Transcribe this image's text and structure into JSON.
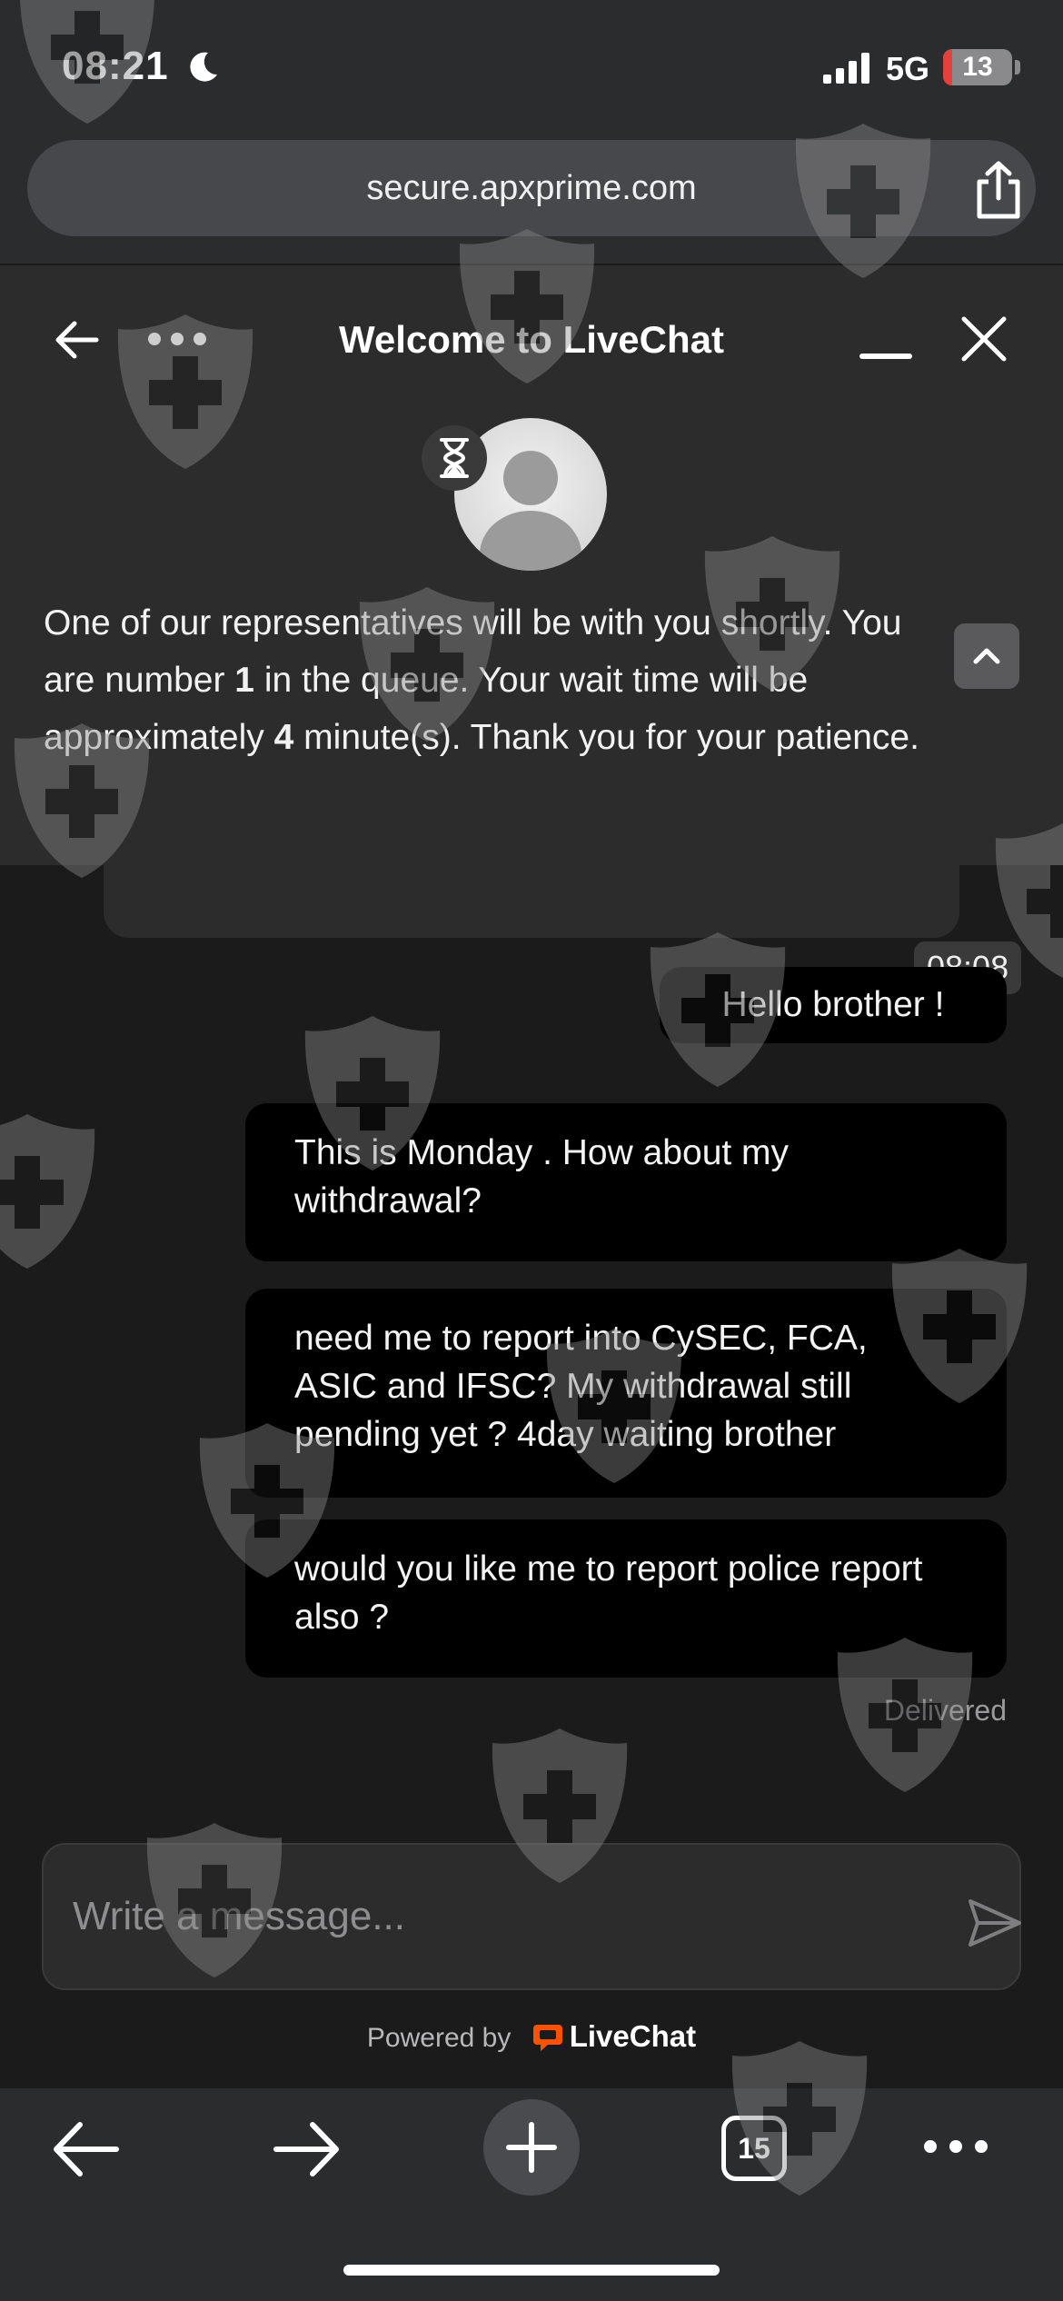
{
  "status_bar": {
    "time": "08:21",
    "network": "5G",
    "battery": "13",
    "battery_level": 0.13,
    "icons": [
      "moon-icon",
      "signal-icon",
      "battery-icon"
    ]
  },
  "browser": {
    "url": "secure.apxprime.com",
    "icons": [
      "share-icon"
    ]
  },
  "chat_header": {
    "title": "Welcome to LiveChat",
    "queue_text_1": "One of our representatives will be with you shortly. You are number ",
    "queue_number": "1",
    "queue_text_2": " in the queue. Your wait time will be approximately ",
    "wait_minutes": "4",
    "queue_text_3": " minute(s). Thank you for your patience.",
    "icons": [
      "back-icon",
      "more-icon",
      "minimize-icon",
      "close-icon",
      "hourglass-icon",
      "chevron-up-icon"
    ]
  },
  "messages": {
    "timestamp": "08:08",
    "items": [
      {
        "text": "Hello brother !"
      },
      {
        "text": "This is Monday . How about my withdrawal?"
      },
      {
        "text": "need me to report into CySEC, FCA, ASIC and IFSC? My withdrawal still pending yet ? 4day waiting brother"
      },
      {
        "text": "would you like me to report police report also ?"
      }
    ],
    "status": "Delivered"
  },
  "composer": {
    "placeholder": "Write a message...",
    "powered_by": "Powered by",
    "brand": "LiveChat",
    "brand_color": "#ff5100"
  },
  "toolbar": {
    "tab_count": "15",
    "icons": [
      "back-arrow-icon",
      "forward-arrow-icon",
      "plus-icon",
      "tabs-icon",
      "more-icon"
    ]
  },
  "colors": {
    "header_bg": "#2c2c2d",
    "chat_bg": "#1b1b1c",
    "bubble_bg": "#000000",
    "chrome_bg": "#2b2c2e"
  }
}
